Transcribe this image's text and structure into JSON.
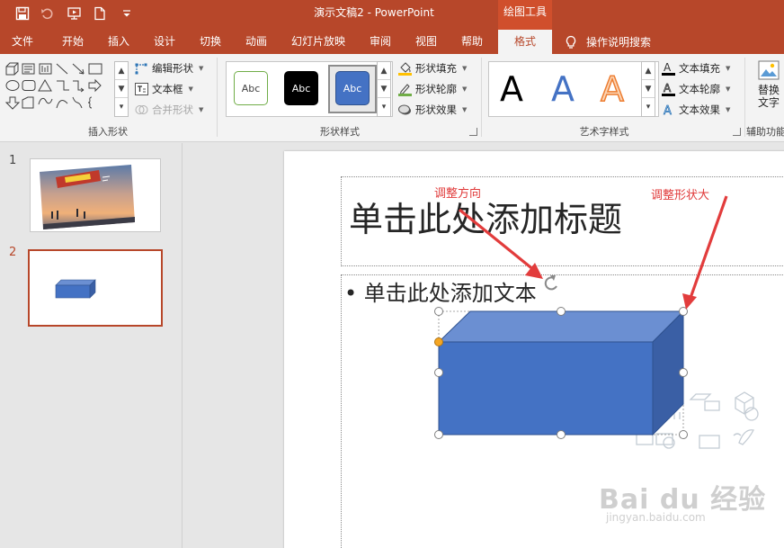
{
  "window": {
    "doc_title": "演示文稿2 - PowerPoint",
    "context_tab": "绘图工具"
  },
  "tabs": [
    "文件",
    "开始",
    "插入",
    "设计",
    "切换",
    "动画",
    "幻灯片放映",
    "审阅",
    "视图",
    "帮助",
    "格式"
  ],
  "active_tab": "格式",
  "help_search": "操作说明搜索",
  "ribbon": {
    "insert_shapes": {
      "label": "插入形状",
      "edit_shape": "编辑形状",
      "text_box": "文本框",
      "merge_shapes": "合并形状"
    },
    "shape_styles": {
      "label": "形状样式",
      "thumb_text": "Abc",
      "fill": "形状填充",
      "outline": "形状轮廓",
      "effects": "形状效果"
    },
    "wordart": {
      "label": "艺术字样式",
      "letter": "A",
      "text_fill": "文本填充",
      "text_outline": "文本轮廓",
      "text_effects": "文本效果"
    },
    "accessibility": {
      "label": "辅助功能",
      "alt_text_line1": "替换",
      "alt_text_line2": "文字"
    }
  },
  "slides": {
    "numbers": [
      "1",
      "2"
    ],
    "selected": "2"
  },
  "slide": {
    "title_placeholder": "单击此处添加标题",
    "body_placeholder": "单击此处添加文本",
    "bullet": "•"
  },
  "annotations": {
    "rotate": "调整方向",
    "resize": "调整形状大"
  },
  "watermark": {
    "brand": "Bai du 经验",
    "url": "jingyan.baidu.com"
  },
  "colors": {
    "accent": "#b7472a",
    "shape_front": "#4472c4",
    "shape_top": "#6b8fd2",
    "shape_side": "#3a5fa5",
    "annotation": "#e03a3a"
  }
}
